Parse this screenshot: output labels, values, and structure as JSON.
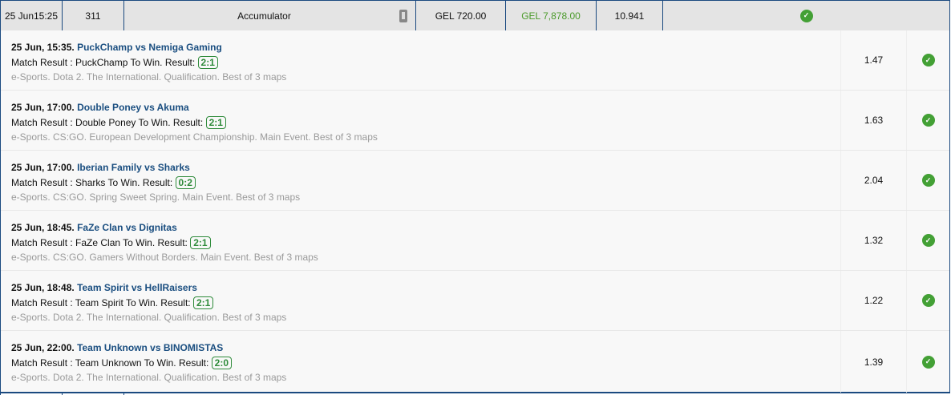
{
  "header": {
    "date": "25 Jun",
    "time": "15:25",
    "id": "311",
    "type": "Accumulator",
    "device_icon": "mobile-phone-icon",
    "stake": "GEL 720.00",
    "payout": "GEL 7,878.00",
    "odds": "10.941",
    "status_icon": "check-circle-icon"
  },
  "colors": {
    "border": "#1b4a80",
    "win": "#43a035",
    "teams": "#1a4e80"
  },
  "selections": [
    {
      "datetime": "25 Jun, 15:35.",
      "teams": "PuckChamp vs Nemiga Gaming",
      "market": "Match Result : PuckChamp To Win. Result:",
      "result": "2:1",
      "desc": "e-Sports. Dota 2. The International. Qualification. Best of 3 maps",
      "odds": "1.47"
    },
    {
      "datetime": "25 Jun, 17:00.",
      "teams": "Double Poney vs Akuma",
      "market": "Match Result : Double Poney To Win. Result:",
      "result": "2:1",
      "desc": "e-Sports. CS:GO. European Development Championship. Main Event. Best of 3 maps",
      "odds": "1.63"
    },
    {
      "datetime": "25 Jun, 17:00.",
      "teams": "Iberian Family vs Sharks",
      "market": "Match Result : Sharks To Win. Result:",
      "result": "0:2",
      "desc": "e-Sports. CS:GO. Spring Sweet Spring. Main Event. Best of 3 maps",
      "odds": "2.04"
    },
    {
      "datetime": "25 Jun, 18:45.",
      "teams": "FaZe Clan vs Dignitas",
      "market": "Match Result : FaZe Clan To Win. Result:",
      "result": "2:1",
      "desc": "e-Sports. CS:GO. Gamers Without Borders. Main Event. Best of 3 maps",
      "odds": "1.32"
    },
    {
      "datetime": "25 Jun, 18:48.",
      "teams": "Team Spirit vs HellRaisers",
      "market": "Match Result : Team Spirit To Win. Result:",
      "result": "2:1",
      "desc": "e-Sports. Dota 2. The International. Qualification. Best of 3 maps",
      "odds": "1.22"
    },
    {
      "datetime": "25 Jun, 22:00.",
      "teams": "Team Unknown vs BINOMISTAS",
      "market": "Match Result : Team Unknown To Win. Result:",
      "result": "2:0",
      "desc": "e-Sports. Dota 2. The International. Qualification. Best of 3 maps",
      "odds": "1.39"
    }
  ]
}
